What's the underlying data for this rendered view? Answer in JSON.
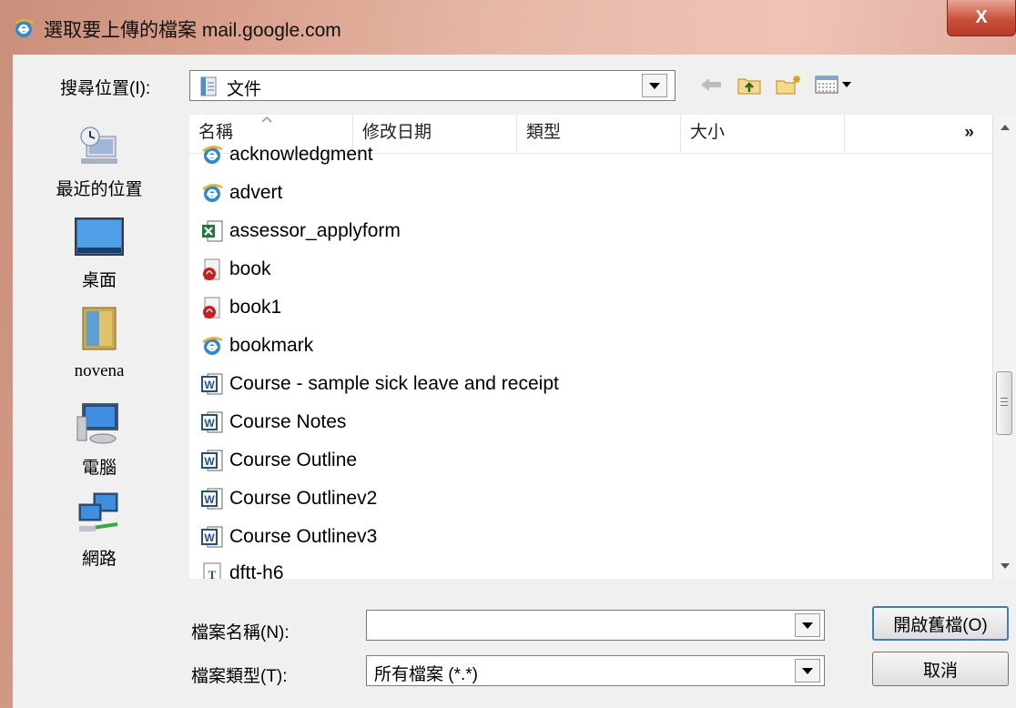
{
  "window": {
    "title": "選取要上傳的檔案 mail.google.com",
    "close_label": "X"
  },
  "toolbar": {
    "lookin_label": "搜尋位置(I):",
    "lookin_value": "文件"
  },
  "places": [
    {
      "label": "最近的位置"
    },
    {
      "label": "桌面"
    },
    {
      "label": "novena"
    },
    {
      "label": "電腦"
    },
    {
      "label": "網路"
    }
  ],
  "columns": [
    {
      "label": "名稱"
    },
    {
      "label": "修改日期"
    },
    {
      "label": "類型"
    },
    {
      "label": "大小"
    },
    {
      "label": "»"
    }
  ],
  "files": [
    {
      "name": "acknowledgment",
      "icon": "ie-html-icon"
    },
    {
      "name": "advert",
      "icon": "ie-html-icon"
    },
    {
      "name": "assessor_applyform",
      "icon": "excel-file-icon"
    },
    {
      "name": "book",
      "icon": "pdf-file-icon"
    },
    {
      "name": "book1",
      "icon": "pdf-file-icon"
    },
    {
      "name": "bookmark",
      "icon": "ie-html-icon"
    },
    {
      "name": "Course - sample sick leave and receipt",
      "icon": "word-file-icon"
    },
    {
      "name": "Course Notes",
      "icon": "word-file-icon"
    },
    {
      "name": "Course Outline",
      "icon": "word-file-icon"
    },
    {
      "name": "Course Outlinev2",
      "icon": "word-file-icon"
    },
    {
      "name": "Course Outlinev3",
      "icon": "word-file-icon"
    },
    {
      "name": "dftt-h6",
      "icon": "font-file-icon"
    }
  ],
  "bottom": {
    "filename_label": "檔案名稱(N):",
    "filename_value": "",
    "filetype_label": "檔案類型(T):",
    "filetype_value": "所有檔案 (*.*)",
    "open_button": "開啟舊檔(O)",
    "cancel_button": "取消"
  }
}
